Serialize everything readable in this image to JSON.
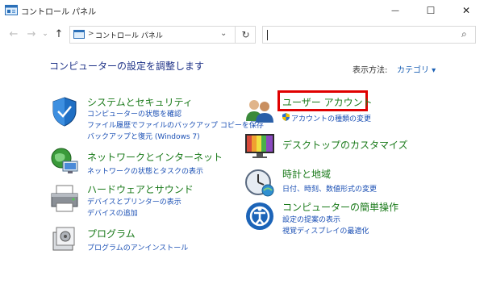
{
  "window": {
    "title": "コントロール パネル",
    "minimize_glyph": "—",
    "maximize_glyph": "☐",
    "close_glyph": "✕"
  },
  "address_bar": {
    "back_glyph": "←",
    "forward_glyph": "→",
    "up_glyph": "↑",
    "separator": ">",
    "path": "コントロール パネル",
    "dropdown_glyph": "⌄",
    "refresh_glyph": "↻",
    "search_placeholder": "",
    "search_glyph": "⌕"
  },
  "main": {
    "heading": "コンピューターの設定を調整します",
    "view_by_label": "表示方法:",
    "view_by_value": "カテゴリ ▾"
  },
  "categories_left": [
    {
      "icon": "shield-icon",
      "title": "システムとセキュリティ",
      "links": [
        "コンピューターの状態を確認",
        "ファイル履歴でファイルのバックアップ コピーを保存",
        "バックアップと復元 (Windows 7)"
      ]
    },
    {
      "icon": "network-icon",
      "title": "ネットワークとインターネット",
      "links": [
        "ネットワークの状態とタスクの表示"
      ]
    },
    {
      "icon": "printer-icon",
      "title": "ハードウェアとサウンド",
      "links": [
        "デバイスとプリンターの表示",
        "デバイスの追加"
      ]
    },
    {
      "icon": "programs-icon",
      "title": "プログラム",
      "links": [
        "プログラムのアンインストール"
      ]
    }
  ],
  "categories_right": [
    {
      "icon": "users-icon",
      "title": "ユーザー アカウント",
      "links": [
        "アカウントの種類の変更"
      ]
    },
    {
      "icon": "desktop-icon",
      "title": "デスクトップのカスタマイズ",
      "links": []
    },
    {
      "icon": "clock-icon",
      "title": "時計と地域",
      "links": [
        "日付、時刻、数値形式の変更"
      ]
    },
    {
      "icon": "ease-of-access-icon",
      "title": "コンピューターの簡単操作",
      "links": [
        "設定の提案の表示",
        "視覚ディスプレイの最適化"
      ]
    }
  ],
  "colors": {
    "heading": "#1e3287",
    "category_title": "#1a7a1a",
    "link": "#1a4fb4",
    "highlight_box": "#e00000"
  }
}
